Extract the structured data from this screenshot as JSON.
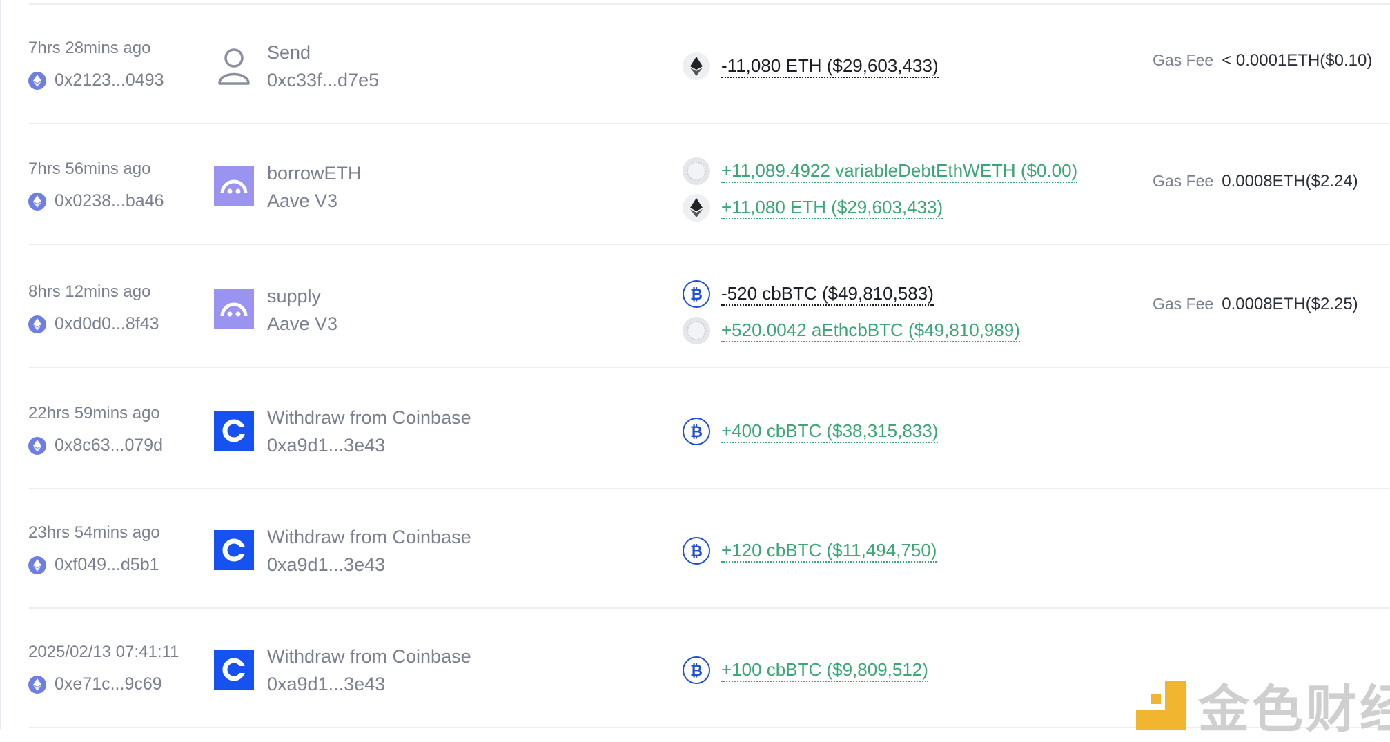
{
  "gas_fee_label": "Gas Fee",
  "watermark_text": "金色财经",
  "colors": {
    "outgoing": "#1b1e26",
    "incoming": "#3aa774",
    "coinbase": "#1652f0",
    "aave": "#9a94f0",
    "btc": "#1e4fd6"
  },
  "rows": [
    {
      "time": "7hrs 28mins ago",
      "hash": "0x2123...0493",
      "avatar_icon": "user-icon",
      "method": "Send",
      "party": "0xc33f...d7e5",
      "transfers": [
        {
          "token_icon": "eth-icon",
          "amount": "-11,080 ETH ($29,603,433)",
          "direction": "out"
        }
      ],
      "gas_fee": "< 0.0001ETH($0.10)"
    },
    {
      "time": "7hrs 56mins ago",
      "hash": "0x0238...ba46",
      "avatar_icon": "aave-logo",
      "method": "borrowETH",
      "party": "Aave V3",
      "transfers": [
        {
          "token_icon": "debt-token-icon",
          "amount": "+11,089.4922 variableDebtEthWETH ($0.00)",
          "direction": "in"
        },
        {
          "token_icon": "eth-icon",
          "amount": "+11,080 ETH ($29,603,433)",
          "direction": "in"
        }
      ],
      "gas_fee": "0.0008ETH($2.24)"
    },
    {
      "time": "8hrs 12mins ago",
      "hash": "0xd0d0...8f43",
      "avatar_icon": "aave-logo",
      "method": "supply",
      "party": "Aave V3",
      "transfers": [
        {
          "token_icon": "cbbtc-icon",
          "amount": "-520 cbBTC ($49,810,583)",
          "direction": "out"
        },
        {
          "token_icon": "debt-token-icon",
          "amount": "+520.0042 aEthcbBTC ($49,810,989)",
          "direction": "in"
        }
      ],
      "gas_fee": "0.0008ETH($2.25)"
    },
    {
      "time": "22hrs 59mins ago",
      "hash": "0x8c63...079d",
      "avatar_icon": "coinbase-logo",
      "method": "Withdraw from Coinbase",
      "party": "0xa9d1...3e43",
      "transfers": [
        {
          "token_icon": "cbbtc-icon",
          "amount": "+400 cbBTC ($38,315,833)",
          "direction": "in"
        }
      ],
      "gas_fee": ""
    },
    {
      "time": "23hrs 54mins ago",
      "hash": "0xf049...d5b1",
      "avatar_icon": "coinbase-logo",
      "method": "Withdraw from Coinbase",
      "party": "0xa9d1...3e43",
      "transfers": [
        {
          "token_icon": "cbbtc-icon",
          "amount": "+120 cbBTC ($11,494,750)",
          "direction": "in"
        }
      ],
      "gas_fee": ""
    },
    {
      "time": "2025/02/13 07:41:11",
      "hash": "0xe71c...9c69",
      "avatar_icon": "coinbase-logo",
      "method": "Withdraw from Coinbase",
      "party": "0xa9d1...3e43",
      "transfers": [
        {
          "token_icon": "cbbtc-icon",
          "amount": "+100 cbBTC ($9,809,512)",
          "direction": "in"
        }
      ],
      "gas_fee": ""
    }
  ]
}
